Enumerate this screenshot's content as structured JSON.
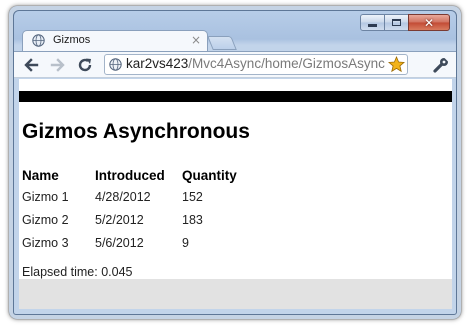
{
  "browser": {
    "tab_title": "Gizmos",
    "tab_close": "×",
    "url_host": "kar2vs423",
    "url_path": "/Mvc4Async/home/GizmosAsync"
  },
  "page": {
    "title": "Gizmos Asynchronous",
    "table": {
      "headers": [
        "Name",
        "Introduced",
        "Quantity"
      ],
      "rows": [
        [
          "Gizmo 1",
          "4/28/2012",
          "152"
        ],
        [
          "Gizmo 2",
          "5/2/2012",
          "183"
        ],
        [
          "Gizmo 3",
          "5/6/2012",
          "9"
        ]
      ]
    },
    "elapsed": "Elapsed time: 0.045"
  },
  "icons": {
    "back": "back-arrow-icon",
    "forward": "forward-arrow-icon",
    "reload": "reload-icon",
    "page": "globe-icon",
    "bookmark": "star-icon",
    "menu": "wrench-icon"
  },
  "colors": {
    "frame": "#c2d4ea",
    "topbar": "#000000",
    "footer": "#e2e2e2",
    "star": "#f2b319"
  }
}
